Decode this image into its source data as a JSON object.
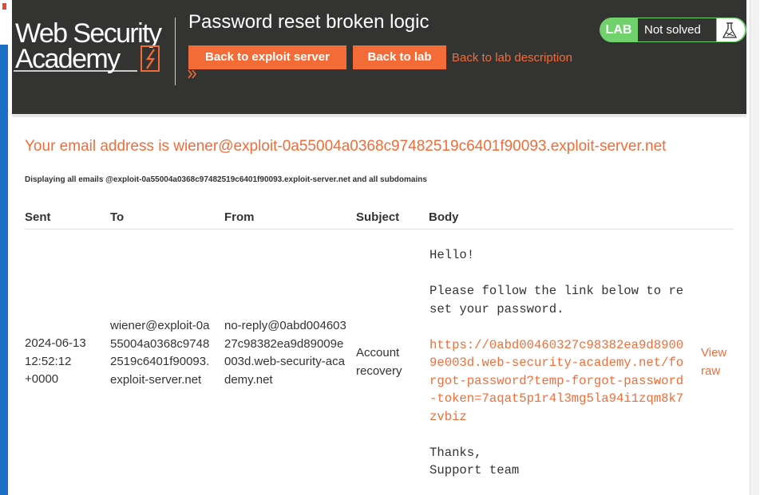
{
  "header": {
    "logo_line1": "Web Security",
    "logo_line2": "Academy",
    "lab_title": "Password reset broken logic",
    "back_to_exploit_label": "Back to exploit server",
    "back_to_lab_label": "Back to lab",
    "back_to_description_label": "Back to lab description",
    "status_prefix": "LAB",
    "status_text": "Not solved"
  },
  "colors": {
    "accent": "#f36c38",
    "header_bg": "#333332",
    "status_green": "#70d16d"
  },
  "main": {
    "email_heading": "Your email address is wiener@exploit-0a55004a0368c97482519c6401f90093.exploit-server.net",
    "displaying_text": "Displaying all emails @exploit-0a55004a0368c97482519c6401f90093.exploit-server.net and all subdomains",
    "columns": [
      "Sent",
      "To",
      "From",
      "Subject",
      "Body"
    ],
    "emails": [
      {
        "sent": "2024-06-13 12:52:12 +0000",
        "to": "wiener@exploit-0a55004a0368c97482519c6401f90093.exploit-server.net",
        "from": "no-reply@0abd00460327c98382ea9d89009e003d.web-security-academy.net",
        "subject": "Account recovery",
        "body_greeting": "Hello!",
        "body_instruction": "Please follow the link below to reset your password.",
        "body_link": "https://0abd00460327c98382ea9d89009e003d.web-security-academy.net/forgot-password?temp-forgot-password-token=7aqat5p1r4l3mg5la94i1zqm8k7zvbiz",
        "body_signoff": "Thanks,",
        "body_signature": "Support team",
        "view_raw_label": "View raw"
      }
    ]
  }
}
